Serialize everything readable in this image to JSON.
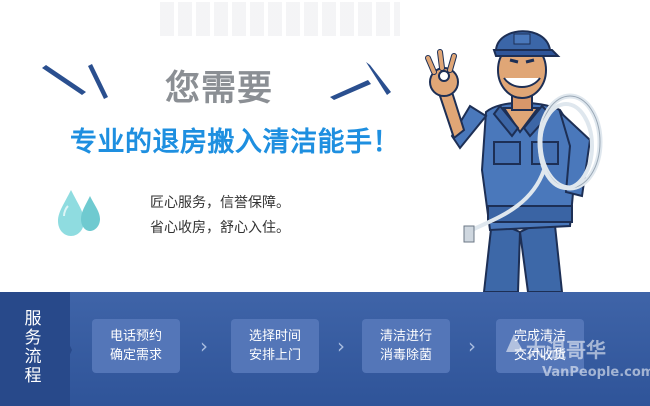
{
  "hero": {
    "headline_small": "您需要",
    "headline_main": "专业的退房搬入清洁能手！",
    "tagline_line1": "匠心服务，信誉保障。",
    "tagline_line2": "省心收房，舒心入住。"
  },
  "process": {
    "label": "服务流程",
    "steps": [
      {
        "line1": "电话预约",
        "line2": "确定需求"
      },
      {
        "line1": "选择时间",
        "line2": "安排上门"
      },
      {
        "line1": "清洁进行",
        "line2": "消毒除菌"
      },
      {
        "line1": "完成清洁",
        "line2": "交付收货"
      }
    ]
  },
  "watermark": {
    "brand": "大温哥华",
    "url": "VanPeople.com"
  },
  "colors": {
    "accent_blue": "#1e8fe0",
    "bar_blue": "#3f64a8",
    "step_blue": "#5476b8",
    "drop_cyan": "#7fd3d8"
  },
  "icons": [
    "water-drops-icon",
    "chevron-right-icon",
    "worker-mascot-illustration"
  ]
}
